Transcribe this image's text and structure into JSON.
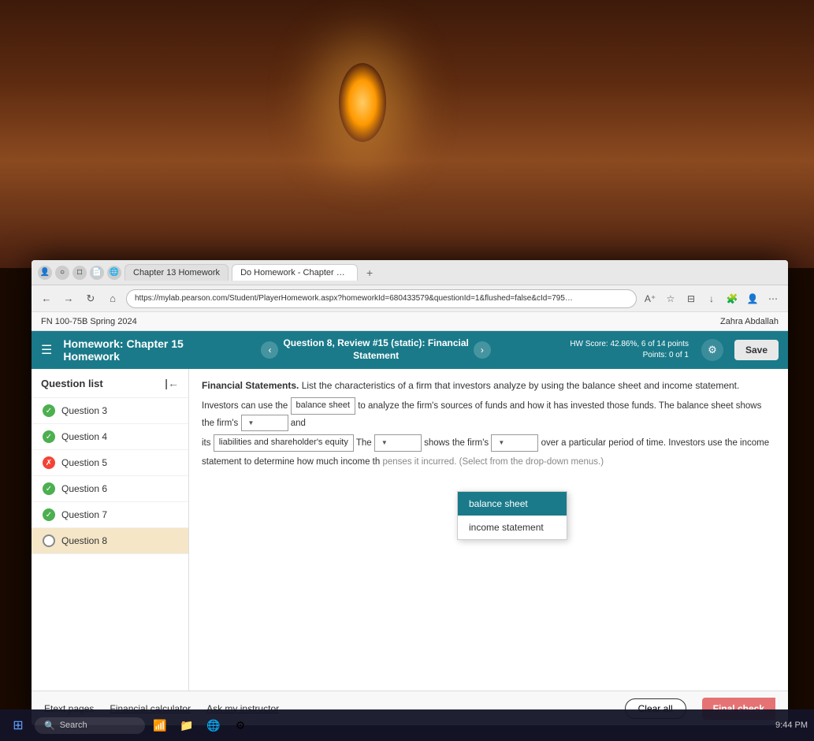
{
  "room": {
    "bg_description": "dimly lit room with lamp"
  },
  "browser": {
    "tabs": [
      {
        "id": "tab1",
        "label": "Chapter 13 Homework",
        "active": false
      },
      {
        "id": "tab2",
        "label": "Do Homework - Chapter 15 Hom…",
        "active": true
      }
    ],
    "tab_plus": "+",
    "address_bar": "https://mylab.pearson.com/Student/PlayerHomework.aspx?homeworkId=680433579&questionId=1&flushed=false&cId=795433...",
    "site_header": "FN 100-75B Spring 2024",
    "user_name": "Zahra Abdallah",
    "nav_back": "←",
    "nav_forward": "→",
    "nav_refresh": "↻",
    "nav_home": "⌂"
  },
  "homework": {
    "title": "Homework: Chapter 15 Homework",
    "question_nav": {
      "prev": "‹",
      "next": "›",
      "title_line1": "Question 8, Review #15 (static): Financial",
      "title_line2": "Statement"
    },
    "score": {
      "hw_score_label": "HW Score: 42.86%, 6 of 14 points",
      "points_label": "Points: 0 of 1"
    },
    "save_btn": "Save",
    "settings_icon": "⚙"
  },
  "sidebar": {
    "title": "Question list",
    "collapse_icon": "|←",
    "questions": [
      {
        "id": "q3",
        "label": "Question 3",
        "status": "correct"
      },
      {
        "id": "q4",
        "label": "Question 4",
        "status": "correct"
      },
      {
        "id": "q5",
        "label": "Question 5",
        "status": "incorrect"
      },
      {
        "id": "q6",
        "label": "Question 6",
        "status": "correct"
      },
      {
        "id": "q7",
        "label": "Question 7",
        "status": "correct"
      },
      {
        "id": "q8",
        "label": "Question 8",
        "status": "unanswered"
      }
    ]
  },
  "question": {
    "section_label": "Financial Statements.",
    "intro_text": "List the characteristics of a firm that investors analyze by using the balance sheet and income statement.",
    "line1_prefix": "Investors can use the",
    "line1_box": "balance sheet",
    "line1_suffix": "to analyze the firm's sources of funds and how it has invested those funds. The balance sheet shows the firm's",
    "line1_dropdown": "",
    "line1_end": "and",
    "line2_prefix": "its",
    "line2_box": "liabilities and shareholder's equity",
    "line2_mid": "The",
    "line2_dropdown2": "",
    "line2_mid2": "shows the firm's",
    "line2_dropdown3": "",
    "line2_end": "over a particular period of time. Investors use the income",
    "line3_text": "statement to determine how much income th",
    "line3_suffix": "penses it incurred. (Select from the drop-down menus.)"
  },
  "dropdown_popup": {
    "items": [
      {
        "label": "balance sheet",
        "selected": true
      },
      {
        "label": "income statement",
        "selected": false
      }
    ]
  },
  "bottom_toolbar": {
    "etext_pages": "Etext pages",
    "financial_calculator": "Financial calculator",
    "ask_instructor": "Ask my instructor",
    "clear_all": "Clear all",
    "final_check": "Final check"
  },
  "taskbar": {
    "start_icon": "⊞",
    "search_icon": "🔍",
    "search_placeholder": "Search",
    "time": "9:44 PM"
  }
}
